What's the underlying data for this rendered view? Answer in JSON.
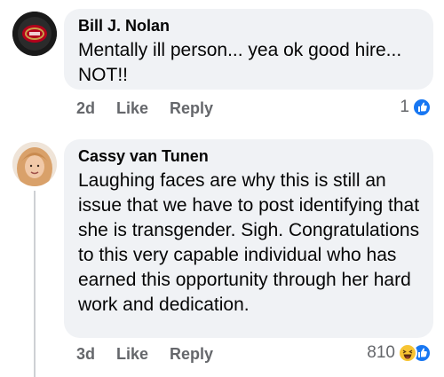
{
  "comments": [
    {
      "author": "Bill J. Nolan",
      "text": "Mentally ill person... yea ok good hire... NOT!!",
      "time": "2d",
      "like_label": "Like",
      "reply_label": "Reply",
      "reaction_count": "1",
      "reaction_icons": [
        "like-icon"
      ]
    },
    {
      "author": "Cassy van Tunen",
      "text": "Laughing faces are why this is still an issue that we have to post identifying that she is transgender. Sigh. Congratulations to this very capable individual who has earned this opportunity through her hard work and dedication.",
      "time": "3d",
      "like_label": "Like",
      "reply_label": "Reply",
      "reaction_count": "810",
      "reaction_icons": [
        "haha-icon",
        "like-icon"
      ]
    }
  ],
  "colors": {
    "bubble": "#f0f2f5",
    "muted": "#65676b",
    "like_blue": "#1877f2",
    "haha_yellow": "#f7c433"
  }
}
